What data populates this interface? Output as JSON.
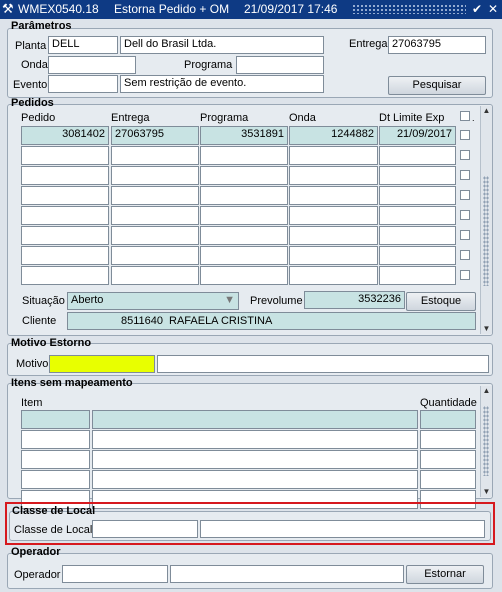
{
  "titlebar": {
    "app_code": "WMEX0540.18",
    "title": "Estorna Pedido + OM",
    "datetime": "21/09/2017 17:46",
    "minimize_glyph": "✔",
    "close_glyph": "✕"
  },
  "parametros": {
    "section_title": "Parâmetros",
    "planta_label": "Planta",
    "planta_code": "DELL",
    "planta_name": "Dell do Brasil Ltda.",
    "entrega_label": "Entrega",
    "entrega_value": "27063795",
    "onda_label": "Onda",
    "onda_value": "",
    "programa_label": "Programa",
    "programa_value": "",
    "evento_label": "Evento",
    "evento_code": "",
    "evento_desc": "Sem restrição de evento.",
    "pesquisar_label": "Pesquisar"
  },
  "pedidos": {
    "section_title": "Pedidos",
    "headers": [
      "Pedido",
      "Entrega",
      "Programa",
      "Onda",
      "Dt Limite Exp"
    ],
    "rows": [
      [
        "3081402",
        "27063795",
        "3531891",
        "1244882",
        "21/09/2017"
      ],
      [
        "",
        "",
        "",
        "",
        ""
      ],
      [
        "",
        "",
        "",
        "",
        ""
      ],
      [
        "",
        "",
        "",
        "",
        ""
      ],
      [
        "",
        "",
        "",
        "",
        ""
      ],
      [
        "",
        "",
        "",
        "",
        ""
      ],
      [
        "",
        "",
        "",
        "",
        ""
      ],
      [
        "",
        "",
        "",
        "",
        ""
      ]
    ],
    "situacao_label": "Situação",
    "situacao_value": "Aberto",
    "prevolume_label": "Prevolume",
    "prevolume_value": "3532236",
    "estoque_label": "Estoque",
    "cliente_label": "Cliente",
    "cliente_code": "8511640",
    "cliente_name": "RAFAELA CRISTINA"
  },
  "motivo_estorno": {
    "section_title": "Motivo Estorno",
    "motivo_label": "Motivo",
    "motivo_code": "",
    "motivo_desc": ""
  },
  "itens": {
    "section_title": "Itens sem mapeamento",
    "item_header": "Item",
    "quantidade_header": "Quantidade"
  },
  "classe_local": {
    "section_title": "Classe de Local",
    "label": "Classe de Local",
    "code": "",
    "desc": ""
  },
  "operador": {
    "section_title": "Operador",
    "label": "Operador",
    "code": "",
    "name": "",
    "estornar_label": "Estornar"
  },
  "colors": {
    "titlebar": "#0e3a84",
    "readonly_field": "#c8e3e3",
    "required_field": "#e8ff00",
    "highlight_border": "#d6191e"
  }
}
